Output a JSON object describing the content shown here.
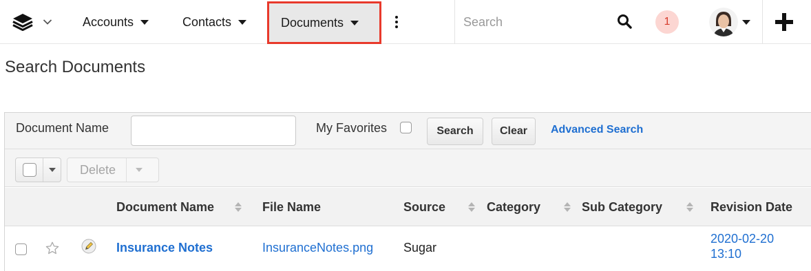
{
  "nav": {
    "modules": [
      "Accounts",
      "Contacts",
      "Documents"
    ],
    "search_placeholder": "Search",
    "notification_count": "1"
  },
  "page": {
    "title": "Search Documents"
  },
  "filter": {
    "document_name_label": "Document Name",
    "document_name_value": "",
    "favorites_label": "My Favorites",
    "search_button": "Search",
    "clear_button": "Clear",
    "advanced_link": "Advanced Search"
  },
  "actions": {
    "delete_label": "Delete"
  },
  "table": {
    "columns": [
      "Document Name",
      "File Name",
      "Source",
      "Category",
      "Sub Category",
      "Revision Date"
    ],
    "rows": [
      {
        "document_name": "Insurance Notes",
        "file_name": "InsuranceNotes.png",
        "source": "Sugar",
        "category": "",
        "sub_category": "",
        "revision_date": "2020-02-20",
        "revision_time": "13:10"
      }
    ]
  },
  "colors": {
    "accent": "#1f6fd1",
    "highlight": "#e8392b",
    "notif_bg": "#fcd6d2"
  },
  "icons": [
    "layers-logo-icon",
    "chevron-down-icon",
    "more-vertical-icon",
    "search-icon",
    "avatar",
    "plus-icon",
    "star-icon",
    "edit-pencil-icon",
    "sort-icon"
  ]
}
